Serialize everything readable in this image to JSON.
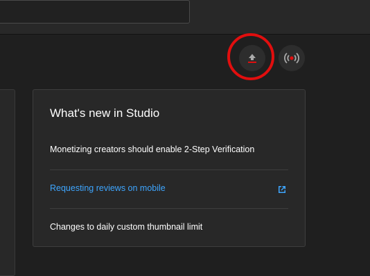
{
  "header": {
    "search_value": ""
  },
  "actions": {
    "upload_icon": "upload-icon",
    "live_icon": "live-broadcast-icon",
    "accent_color": "#e10e0e"
  },
  "whats_new": {
    "title": "What's new in Studio",
    "items": [
      {
        "label": "Monetizing creators should enable 2-Step Verification"
      },
      {
        "label": "Requesting reviews on mobile",
        "icon": "external-link-icon",
        "link_color": "#3ea6ff"
      },
      {
        "label": "Changes to daily custom thumbnail limit"
      }
    ]
  }
}
